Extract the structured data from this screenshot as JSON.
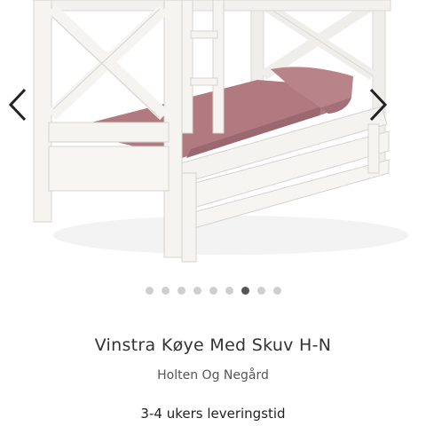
{
  "gallery": {
    "image_alt": "",
    "dot_count": 9,
    "active_dot": 6,
    "prev_icon": "chevron-left-icon",
    "next_icon": "chevron-right-icon"
  },
  "product": {
    "title": "Vinstra Køye Med Skuv H-N",
    "brand": "Holten Og Negård",
    "delivery": "3-4 ukers leveringstid"
  },
  "colors": {
    "frame": "#f4f3f0",
    "mattress": "#b07a80",
    "arrow": "#222222",
    "dot_active": "#555555",
    "dot_inactive": "#cfcfcf"
  }
}
